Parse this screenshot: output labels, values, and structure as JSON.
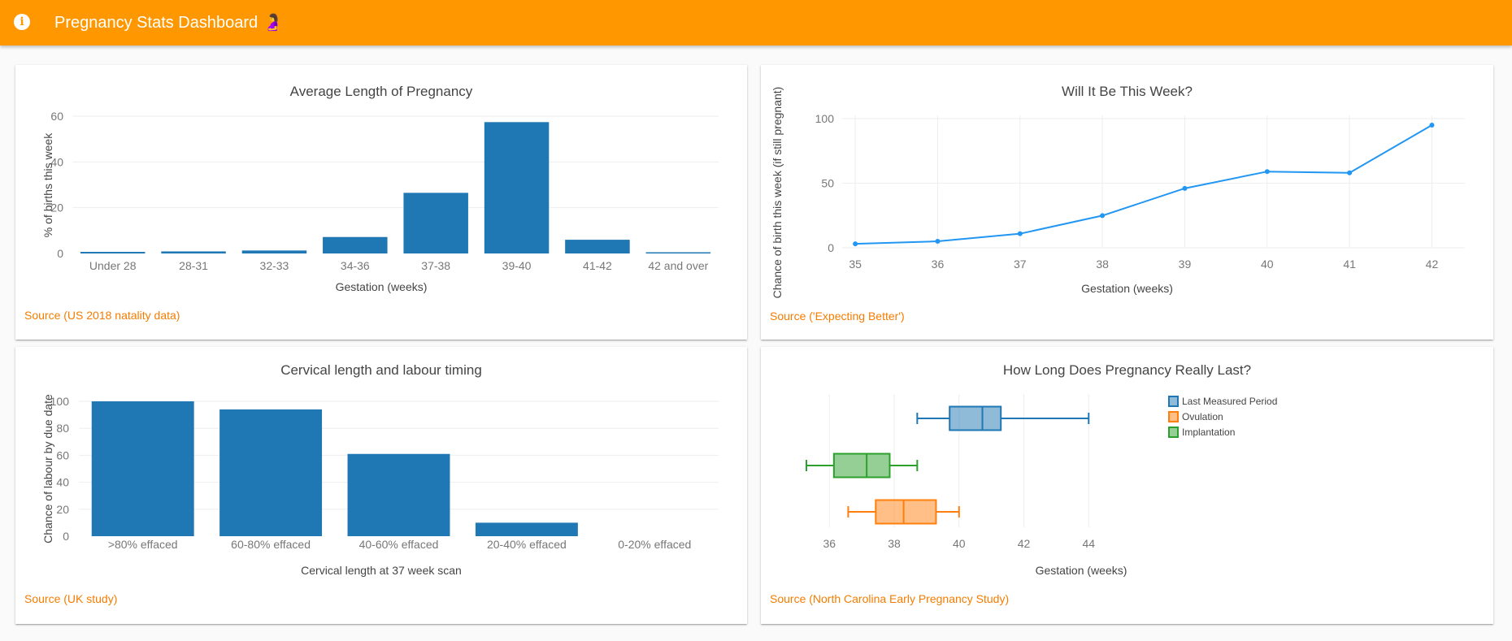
{
  "header": {
    "title": "Pregnancy Stats Dashboard",
    "emoji": "🤰",
    "info_icon": "info-circle-icon",
    "background": "#ff9800"
  },
  "colors": {
    "bar": "#1f77b4",
    "line": "#2196f3",
    "source_link": "#f57c00",
    "box_lmp": "#1f77b4",
    "box_ovulation": "#ff7f0e",
    "box_implantation": "#2ca02c"
  },
  "cards": [
    {
      "source_label": "Source (US 2018 natality data)"
    },
    {
      "source_label": "Source ('Expecting Better')"
    },
    {
      "source_label": "Source (UK study)"
    },
    {
      "source_label": "Source (North Carolina Early Pregnancy Study)"
    }
  ],
  "chart_data": [
    {
      "type": "bar",
      "title": "Average Length of Pregnancy",
      "xlabel": "Gestation (weeks)",
      "ylabel": "% of births this week",
      "categories": [
        "Under 28",
        "28-31",
        "32-33",
        "34-36",
        "37-38",
        "39-40",
        "41-42",
        "42 and over"
      ],
      "values": [
        0.7,
        0.9,
        1.3,
        7.2,
        26.5,
        57.4,
        6.0,
        0.3
      ],
      "ylim": [
        0,
        60
      ],
      "yticks": [
        0,
        20,
        40,
        60
      ],
      "grid": true
    },
    {
      "type": "line",
      "title": "Will It Be This Week?",
      "xlabel": "Gestation (weeks)",
      "ylabel": "Chance of birth this week (if still pregnant)",
      "x": [
        35,
        36,
        37,
        38,
        39,
        40,
        41,
        42
      ],
      "values": [
        3.1,
        5.0,
        10.9,
        24.9,
        46.0,
        59.0,
        58.0,
        95.0
      ],
      "ylim": [
        0,
        100
      ],
      "yticks": [
        0,
        50,
        100
      ],
      "xticks": [
        35,
        36,
        37,
        38,
        39,
        40,
        41,
        42
      ],
      "grid": true
    },
    {
      "type": "bar",
      "title": "Cervical length and labour timing",
      "xlabel": "Cervical length at 37 week scan",
      "ylabel": "Chance of labour by due date",
      "categories": [
        ">80% effaced",
        "60-80% effaced",
        "40-60% effaced",
        "20-40% effaced",
        "0-20% effaced"
      ],
      "values": [
        100,
        94,
        61,
        10,
        0
      ],
      "ylim": [
        0,
        100
      ],
      "yticks": [
        0,
        20,
        40,
        60,
        80,
        100
      ],
      "grid": true
    },
    {
      "type": "box",
      "title": "How Long Does Pregnancy Really Last?",
      "xlabel": "Gestation (weeks)",
      "ylabel": "",
      "xlim": [
        35,
        44.5
      ],
      "xticks": [
        36,
        38,
        40,
        42,
        44
      ],
      "legend_position": "top-right",
      "series": [
        {
          "name": "Last Measured Period",
          "min": 38.71,
          "q1": 39.71,
          "median": 40.72,
          "q3": 41.29,
          "max": 44.0
        },
        {
          "name": "Ovulation",
          "min": 36.58,
          "q1": 37.43,
          "median": 38.29,
          "q3": 39.29,
          "max": 40.0
        },
        {
          "name": "Implantation",
          "min": 35.29,
          "q1": 36.14,
          "median": 37.15,
          "q3": 37.86,
          "max": 38.71
        }
      ],
      "grid": true
    }
  ]
}
